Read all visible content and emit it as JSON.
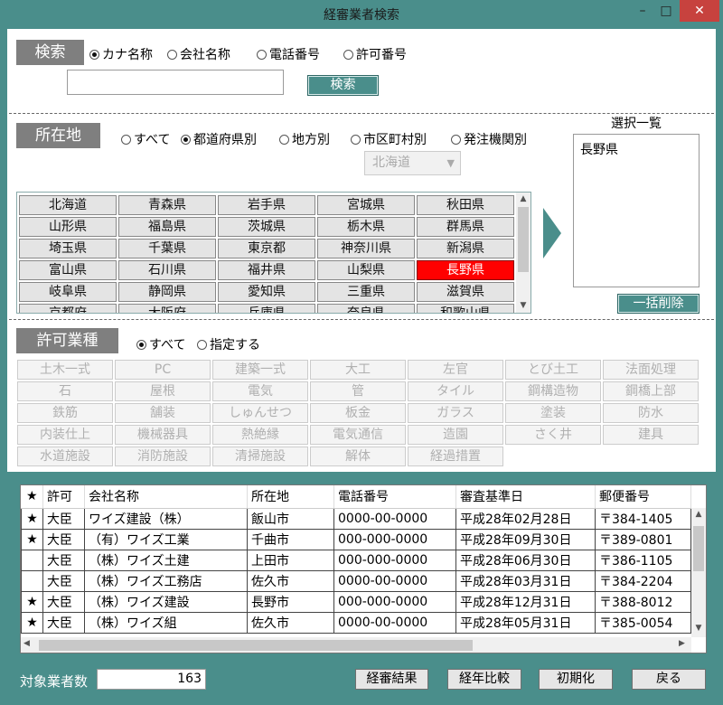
{
  "window": {
    "title": "経審業者検索",
    "minimize": "–",
    "maximize": "□",
    "close": "✕"
  },
  "search": {
    "label": "検索",
    "options": [
      "カナ名称",
      "会社名称",
      "電話番号",
      "許可番号"
    ],
    "selected": 0,
    "input_value": "",
    "button": "検索"
  },
  "location": {
    "label": "所在地",
    "options": [
      "すべて",
      "都道府県別",
      "地方別",
      "市区町村別",
      "発注機関別"
    ],
    "selected": 1,
    "region_select": "北海道",
    "prefectures": [
      "北海道",
      "青森県",
      "岩手県",
      "宮城県",
      "秋田県",
      "山形県",
      "福島県",
      "茨城県",
      "栃木県",
      "群馬県",
      "埼玉県",
      "千葉県",
      "東京都",
      "神奈川県",
      "新潟県",
      "富山県",
      "石川県",
      "福井県",
      "山梨県",
      "長野県",
      "岐阜県",
      "静岡県",
      "愛知県",
      "三重県",
      "滋賀県",
      "京都府",
      "大阪府",
      "兵庫県",
      "奈良県",
      "和歌山県"
    ],
    "selected_prefecture": "長野県",
    "selection_title": "選択一覧",
    "selection_list": [
      "長野県"
    ],
    "clear_all": "一括削除"
  },
  "permit": {
    "label": "許可業種",
    "options": [
      "すべて",
      "指定する"
    ],
    "selected": 0,
    "types": [
      "土木一式",
      "PC",
      "建築一式",
      "大工",
      "左官",
      "とび土工",
      "法面処理",
      "石",
      "屋根",
      "電気",
      "管",
      "タイル",
      "鋼構造物",
      "鋼橋上部",
      "鉄筋",
      "舗装",
      "しゅんせつ",
      "板金",
      "ガラス",
      "塗装",
      "防水",
      "内装仕上",
      "機械器具",
      "熱絶縁",
      "電気通信",
      "造園",
      "さく井",
      "建具",
      "水道施設",
      "消防施設",
      "清掃施設",
      "解体",
      "経過措置"
    ]
  },
  "results": {
    "columns": [
      "★",
      "許可",
      "会社名称",
      "所在地",
      "電話番号",
      "審査基準日",
      "郵便番号"
    ],
    "rows": [
      [
        "★",
        "大臣",
        "ワイズ建設（株）",
        "飯山市",
        "0000-00-0000",
        "平成28年02月28日",
        "〒384-1405"
      ],
      [
        "★",
        "大臣",
        "（有）ワイズ工業",
        "千曲市",
        "000-000-0000",
        "平成28年09月30日",
        "〒389-0801"
      ],
      [
        "",
        "大臣",
        "（株）ワイズ土建",
        "上田市",
        "000-000-0000",
        "平成28年06月30日",
        "〒386-1105"
      ],
      [
        "",
        "大臣",
        "（株）ワイズ工務店",
        "佐久市",
        "0000-00-0000",
        "平成28年03月31日",
        "〒384-2204"
      ],
      [
        "★",
        "大臣",
        "（株）ワイズ建設",
        "長野市",
        "000-000-0000",
        "平成28年12月31日",
        "〒388-8012"
      ],
      [
        "★",
        "大臣",
        "（株）ワイズ組",
        "佐久市",
        "0000-00-0000",
        "平成28年05月31日",
        "〒385-0054"
      ]
    ]
  },
  "footer": {
    "count_label": "対象業者数",
    "count_value": "163",
    "buttons": [
      "経審結果",
      "経年比較",
      "初期化",
      "戻る"
    ]
  },
  "colors": {
    "teal": "#4a8e8b",
    "selected_red": "#ff0000",
    "label_gray": "#7f7f7f"
  }
}
